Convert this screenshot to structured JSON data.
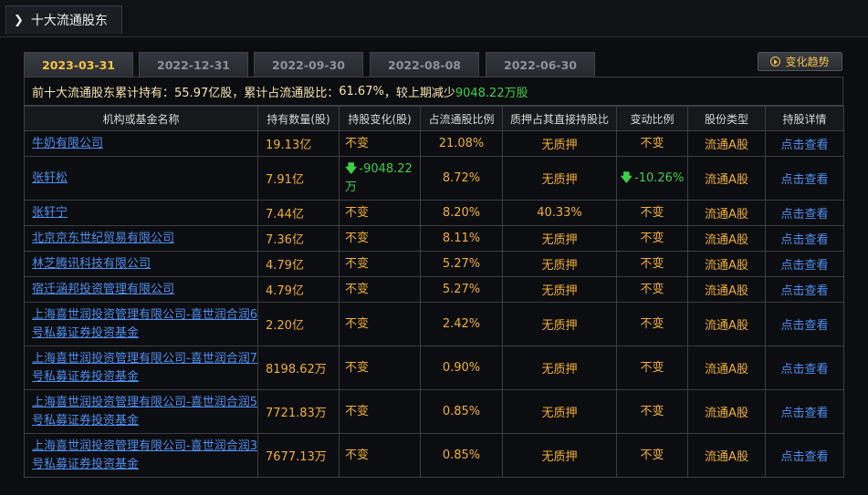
{
  "panel": {
    "title": "十大流通股东"
  },
  "tabs": [
    {
      "label": "2023-03-31",
      "active": true
    },
    {
      "label": "2022-12-31",
      "active": false
    },
    {
      "label": "2022-09-30",
      "active": false
    },
    {
      "label": "2022-08-08",
      "active": false
    },
    {
      "label": "2022-06-30",
      "active": false
    }
  ],
  "trend_button": {
    "label": "变化趋势"
  },
  "summary": {
    "prefix": "前十大流通股东累计持有：",
    "total_shares": "55.97亿股",
    "ratio_label": "，累计占流通股比：",
    "ratio": "61.67%",
    "compare_label": "，较上期减少",
    "change": "9048.22万股"
  },
  "columns": [
    "机构或基金名称",
    "持有数量(股)",
    "持股变化(股)",
    "占流通股比例",
    "质押占其直接持股比",
    "变动比例",
    "股份类型",
    "持股详情"
  ],
  "rows": [
    {
      "name": "牛奶有限公司",
      "qty": "19.13亿",
      "change": "不变",
      "change_dir": "none",
      "ratio": "21.08%",
      "pledge": "无质押",
      "var": "不变",
      "var_dir": "none",
      "type": "流通A股",
      "detail": "点击查看"
    },
    {
      "name": "张轩松",
      "qty": "7.91亿",
      "change": "-9048.22万",
      "change_dir": "down",
      "ratio": "8.72%",
      "pledge": "无质押",
      "var": "-10.26%",
      "var_dir": "down",
      "type": "流通A股",
      "detail": "点击查看"
    },
    {
      "name": "张轩宁",
      "qty": "7.44亿",
      "change": "不变",
      "change_dir": "none",
      "ratio": "8.20%",
      "pledge": "40.33%",
      "var": "不变",
      "var_dir": "none",
      "type": "流通A股",
      "detail": "点击查看"
    },
    {
      "name": "北京京东世纪贸易有限公司",
      "qty": "7.36亿",
      "change": "不变",
      "change_dir": "none",
      "ratio": "8.11%",
      "pledge": "无质押",
      "var": "不变",
      "var_dir": "none",
      "type": "流通A股",
      "detail": "点击查看"
    },
    {
      "name": "林芝腾讯科技有限公司",
      "qty": "4.79亿",
      "change": "不变",
      "change_dir": "none",
      "ratio": "5.27%",
      "pledge": "无质押",
      "var": "不变",
      "var_dir": "none",
      "type": "流通A股",
      "detail": "点击查看"
    },
    {
      "name": "宿迁涵邦投资管理有限公司",
      "qty": "4.79亿",
      "change": "不变",
      "change_dir": "none",
      "ratio": "5.27%",
      "pledge": "无质押",
      "var": "不变",
      "var_dir": "none",
      "type": "流通A股",
      "detail": "点击查看"
    },
    {
      "name": "上海喜世润投资管理有限公司-喜世润合润6号私募证券投资基金",
      "qty": "2.20亿",
      "change": "不变",
      "change_dir": "none",
      "ratio": "2.42%",
      "pledge": "无质押",
      "var": "不变",
      "var_dir": "none",
      "type": "流通A股",
      "detail": "点击查看"
    },
    {
      "name": "上海喜世润投资管理有限公司-喜世润合润7号私募证券投资基金",
      "qty": "8198.62万",
      "change": "不变",
      "change_dir": "none",
      "ratio": "0.90%",
      "pledge": "无质押",
      "var": "不变",
      "var_dir": "none",
      "type": "流通A股",
      "detail": "点击查看"
    },
    {
      "name": "上海喜世润投资管理有限公司-喜世润合润5号私募证券投资基金",
      "qty": "7721.83万",
      "change": "不变",
      "change_dir": "none",
      "ratio": "0.85%",
      "pledge": "无质押",
      "var": "不变",
      "var_dir": "none",
      "type": "流通A股",
      "detail": "点击查看"
    },
    {
      "name": "上海喜世润投资管理有限公司-喜世润合润3号私募证券投资基金",
      "qty": "7677.13万",
      "change": "不变",
      "change_dir": "none",
      "ratio": "0.85%",
      "pledge": "无质押",
      "var": "不变",
      "var_dir": "none",
      "type": "流通A股",
      "detail": "点击查看"
    }
  ],
  "colors": {
    "background": "#0c0d10",
    "accent_gold": "#f2b035",
    "link_blue": "#4f8ff0",
    "down_green": "#3fcf47",
    "border": "#3a3e45"
  },
  "icons": {
    "title": "chevron-right-icon",
    "trend": "play-circle-icon",
    "down": "down-arrow-icon"
  }
}
